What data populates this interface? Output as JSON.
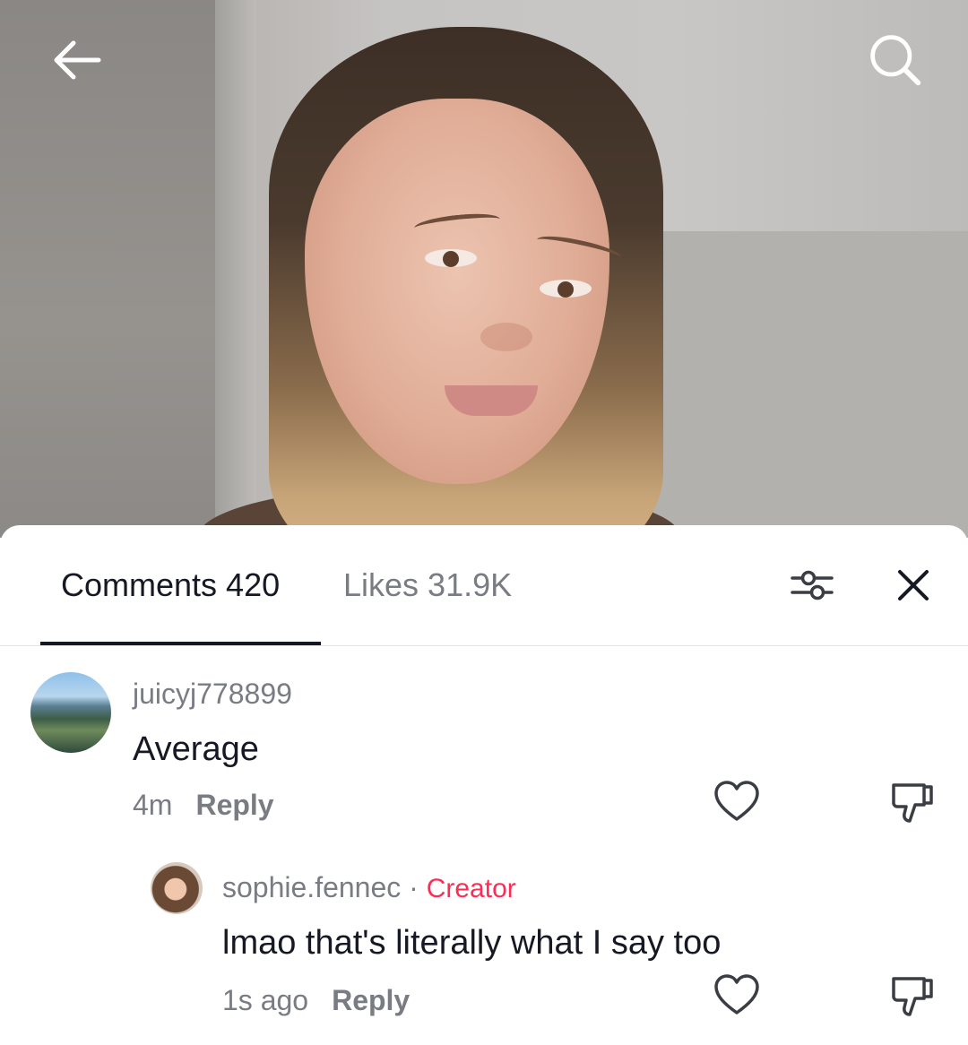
{
  "video": {
    "back_icon": "arrow-left-icon",
    "search_icon": "search-icon"
  },
  "tabs": {
    "comments_label": "Comments 420",
    "likes_label": "Likes 31.9K"
  },
  "toolbar": {
    "filter_icon": "filter-sliders-icon",
    "close_icon": "close-icon"
  },
  "comments": [
    {
      "username": "juicyj778899",
      "text": "Average",
      "time": "4m",
      "reply_label": "Reply",
      "replies": [
        {
          "username": "sophie.fennec",
          "separator": "·",
          "badge": "Creator",
          "text": "lmao that's literally what I say too",
          "time": "1s ago",
          "reply_label": "Reply"
        }
      ]
    }
  ],
  "colors": {
    "accent": "#fe2c55",
    "primary_text": "#161823",
    "secondary_text": "#7a7c84"
  }
}
